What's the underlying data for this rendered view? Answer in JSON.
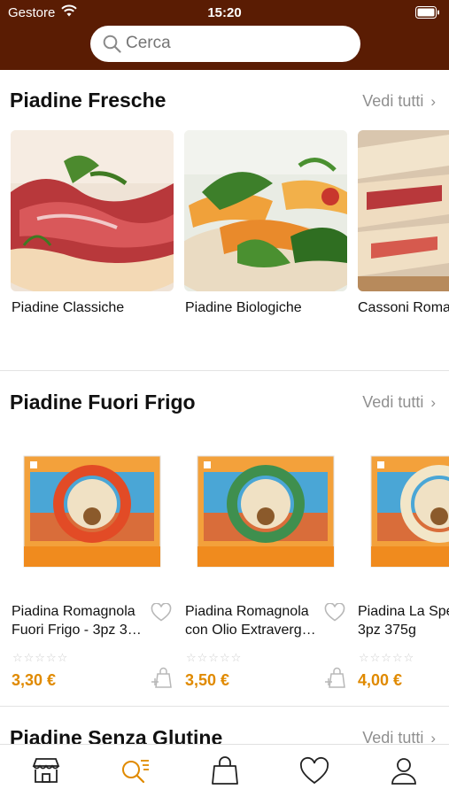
{
  "status_bar": {
    "carrier": "Gestore",
    "time": "15:20"
  },
  "search": {
    "placeholder": "Cerca"
  },
  "sections": [
    {
      "title": "Piadine Fresche",
      "see_all": "Vedi tutti",
      "items": [
        {
          "label": "Piadine Classiche"
        },
        {
          "label": "Piadine Biologiche"
        },
        {
          "label": "Cassoni Roma"
        }
      ]
    },
    {
      "title": "Piadine Fuori Frigo",
      "see_all": "Vedi tutti",
      "products": [
        {
          "name_line1": "Piadina Romagnola",
          "name_line2": "Fuori Frigo - 3pz 3…",
          "price": "3,30 €",
          "rating": 0
        },
        {
          "name_line1": "Piadina Romagnola",
          "name_line2": "con Olio Extraverg…",
          "price": "3,50 €",
          "rating": 0
        },
        {
          "name_line1": "Piadina La Spe",
          "name_line2": "3pz 375g",
          "price": "4,00 €",
          "rating": 0
        }
      ]
    },
    {
      "title": "Piadine Senza Glutine",
      "see_all": "Vedi tutti"
    }
  ],
  "colors": {
    "header": "#5a1c03",
    "price": "#e08a00",
    "active_tab": "#e08a00"
  },
  "tab_bar": [
    "store-icon",
    "search-list-icon",
    "shopping-bag-icon",
    "heart-icon",
    "profile-icon"
  ]
}
